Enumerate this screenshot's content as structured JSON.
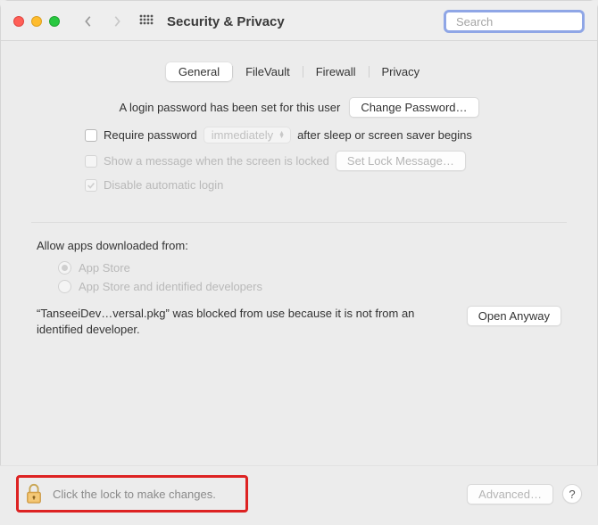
{
  "title": "Security & Privacy",
  "search": {
    "placeholder": "Search"
  },
  "tabs": {
    "general": "General",
    "filevault": "FileVault",
    "firewall": "Firewall",
    "privacy": "Privacy"
  },
  "general": {
    "login_pw_set": "A login password has been set for this user",
    "change_password": "Change Password…",
    "require_pw": "Require password",
    "require_pw_delay": "immediately",
    "after_sleep": "after sleep or screen saver begins",
    "show_message": "Show a message when the screen is locked",
    "set_lock_msg": "Set Lock Message…",
    "disable_auto_login": "Disable automatic login"
  },
  "allow": {
    "label": "Allow apps downloaded from:",
    "appstore": "App Store",
    "appstore_identified": "App Store and identified developers"
  },
  "blocked": {
    "text": "“TanseeiDev…versal.pkg” was blocked from use because it is not from an identified developer.",
    "open_anyway": "Open Anyway"
  },
  "footer": {
    "lock_text": "Click the lock to make changes.",
    "advanced": "Advanced…",
    "help": "?"
  }
}
